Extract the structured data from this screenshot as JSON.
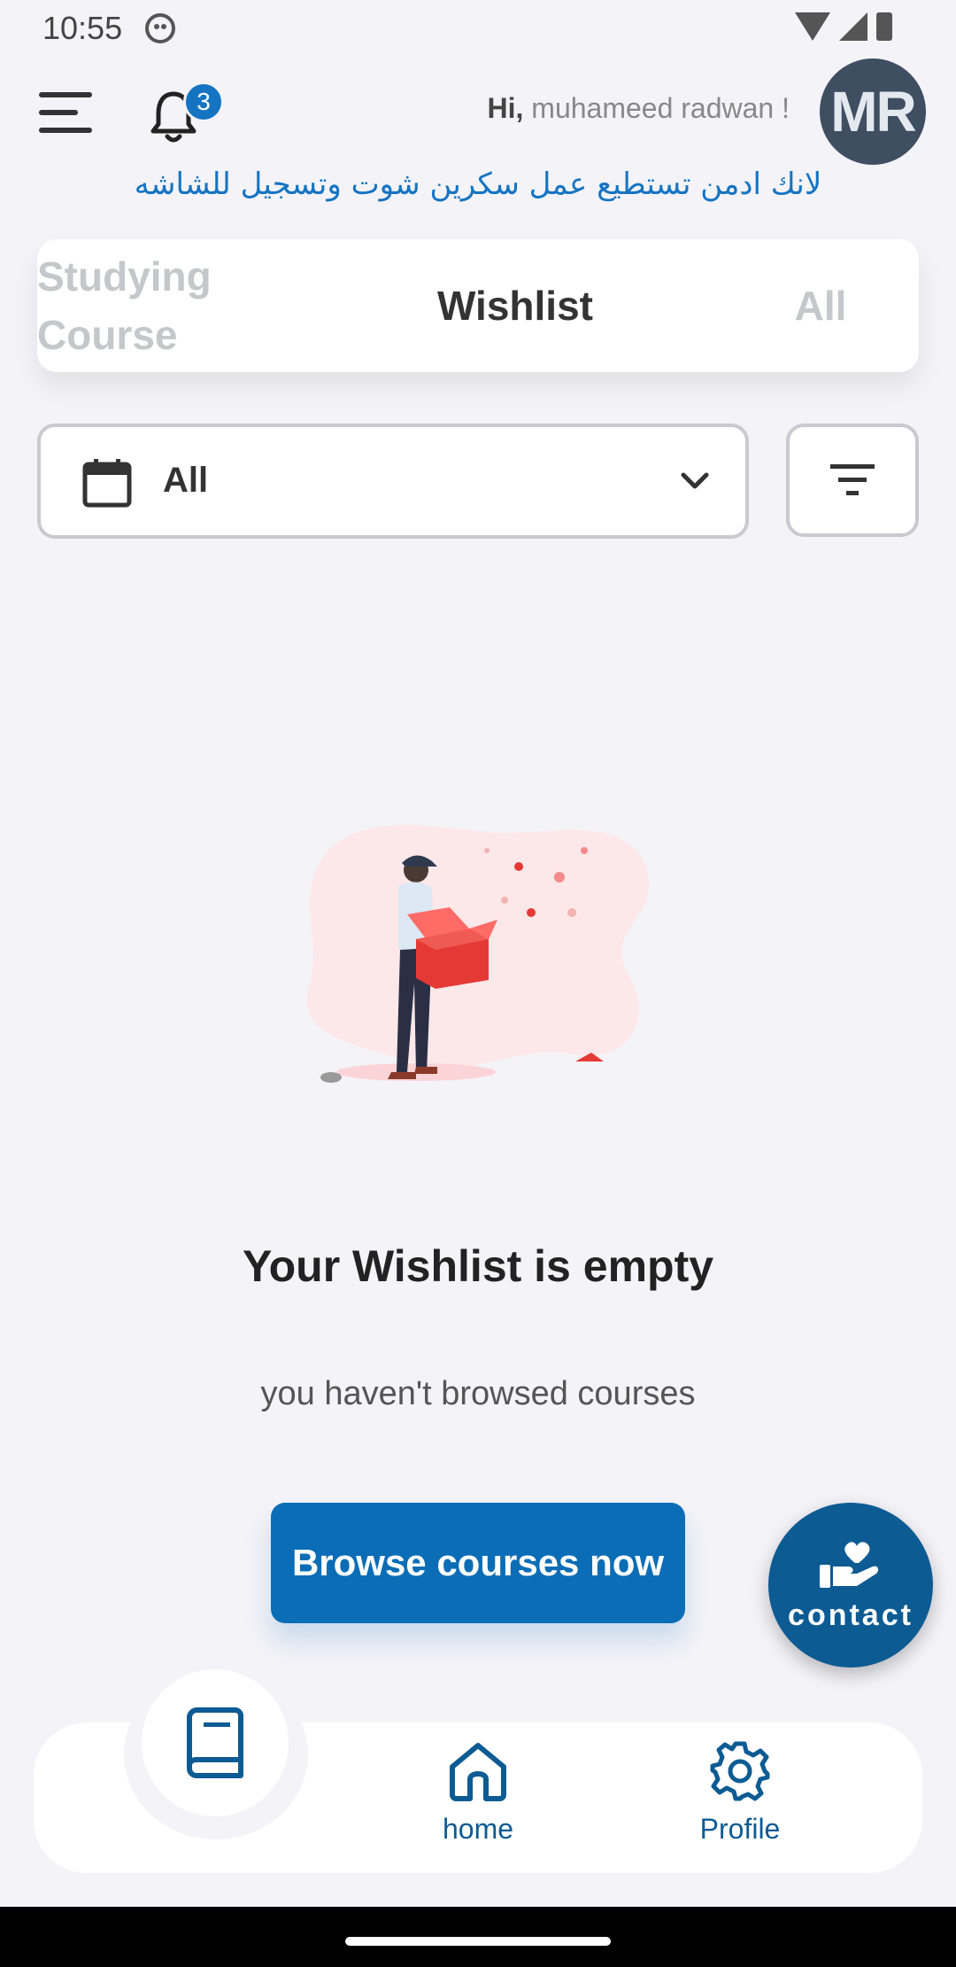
{
  "status_bar": {
    "time": "10:55"
  },
  "header": {
    "notification_count": "3",
    "greeting_prefix": "Hi,",
    "greeting_name": "muhameed radwan !",
    "avatar_initials": "MR"
  },
  "notice": "لانك ادمن تستطيع عمل سكرين شوت وتسجيل للشاشه",
  "tabs": {
    "studying": "Studying Course",
    "wishlist": "Wishlist",
    "all": "All",
    "active": "wishlist"
  },
  "filter": {
    "selected": "All"
  },
  "empty_state": {
    "title": "Your Wishlist is empty",
    "subtitle": "you haven't browsed courses",
    "button": "Browse courses now"
  },
  "contact": {
    "label": "contact"
  },
  "bottom_nav": {
    "home": "home",
    "profile": "Profile"
  },
  "colors": {
    "accent": "#1574c2",
    "button": "#0b6db6",
    "fab": "#0d5b93",
    "background": "#f4f3f8"
  }
}
